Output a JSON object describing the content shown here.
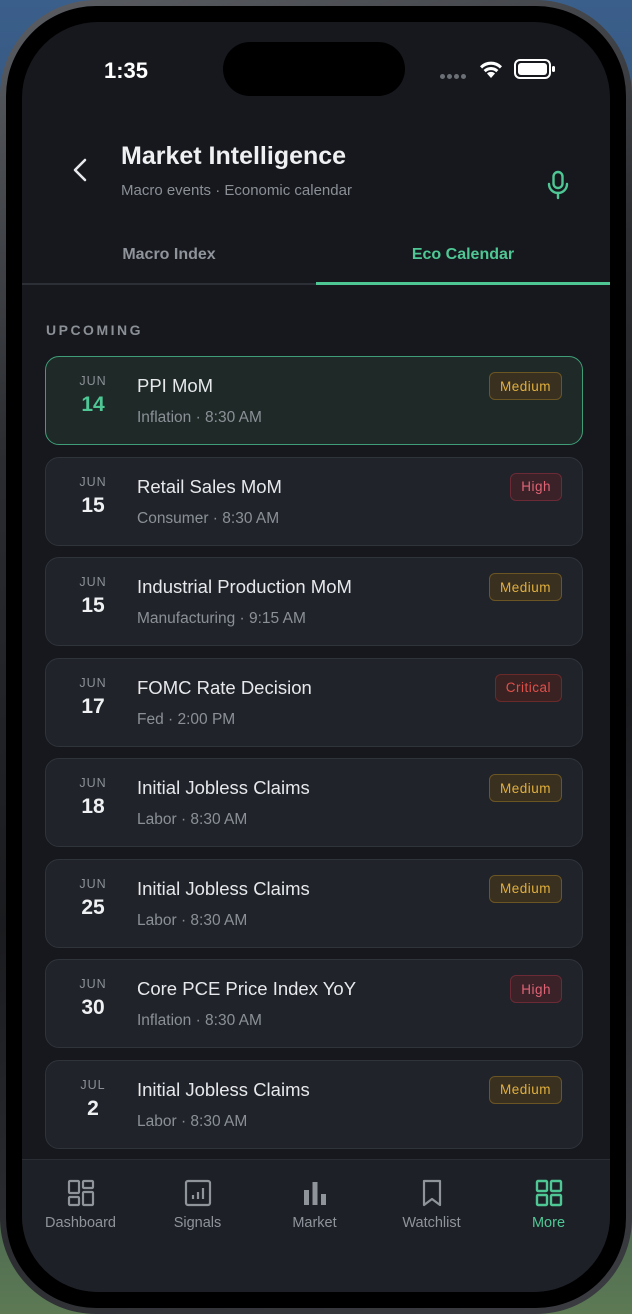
{
  "status_bar": {
    "time": "1:35"
  },
  "header": {
    "title": "Market Intelligence",
    "subtitle": "Macro events · Economic calendar"
  },
  "tabs": [
    {
      "label": "Macro Index",
      "active": false
    },
    {
      "label": "Eco Calendar",
      "active": true
    }
  ],
  "section": {
    "label": "UPCOMING"
  },
  "events": [
    {
      "month": "JUN",
      "day": "14",
      "name": "PPI MoM",
      "meta": "Inflation · 8:30 AM",
      "impact": "Medium",
      "highlight": true
    },
    {
      "month": "JUN",
      "day": "15",
      "name": "Retail Sales MoM",
      "meta": "Consumer · 8:30 AM",
      "impact": "High"
    },
    {
      "month": "JUN",
      "day": "15",
      "name": "Industrial Production MoM",
      "meta": "Manufacturing · 9:15 AM",
      "impact": "Medium"
    },
    {
      "month": "JUN",
      "day": "17",
      "name": "FOMC Rate Decision",
      "meta": "Fed · 2:00 PM",
      "impact": "Critical"
    },
    {
      "month": "JUN",
      "day": "18",
      "name": "Initial Jobless Claims",
      "meta": "Labor · 8:30 AM",
      "impact": "Medium"
    },
    {
      "month": "JUN",
      "day": "25",
      "name": "Initial Jobless Claims",
      "meta": "Labor · 8:30 AM",
      "impact": "Medium"
    },
    {
      "month": "JUN",
      "day": "30",
      "name": "Core PCE Price Index YoY",
      "meta": "Inflation · 8:30 AM",
      "impact": "High"
    },
    {
      "month": "JUL",
      "day": "2",
      "name": "Initial Jobless Claims",
      "meta": "Labor · 8:30 AM",
      "impact": "Medium"
    }
  ],
  "bottom_nav": [
    {
      "label": "Dashboard",
      "icon": "dashboard-icon",
      "active": false
    },
    {
      "label": "Signals",
      "icon": "signals-icon",
      "active": false
    },
    {
      "label": "Market",
      "icon": "bar-chart-icon",
      "active": false
    },
    {
      "label": "Watchlist",
      "icon": "bookmark-icon",
      "active": false
    },
    {
      "label": "More",
      "icon": "grid-icon",
      "active": true
    }
  ],
  "colors": {
    "accent": "#4fc795",
    "medium": "#e0b03e",
    "high": "#e06476",
    "critical": "#e0504a"
  }
}
